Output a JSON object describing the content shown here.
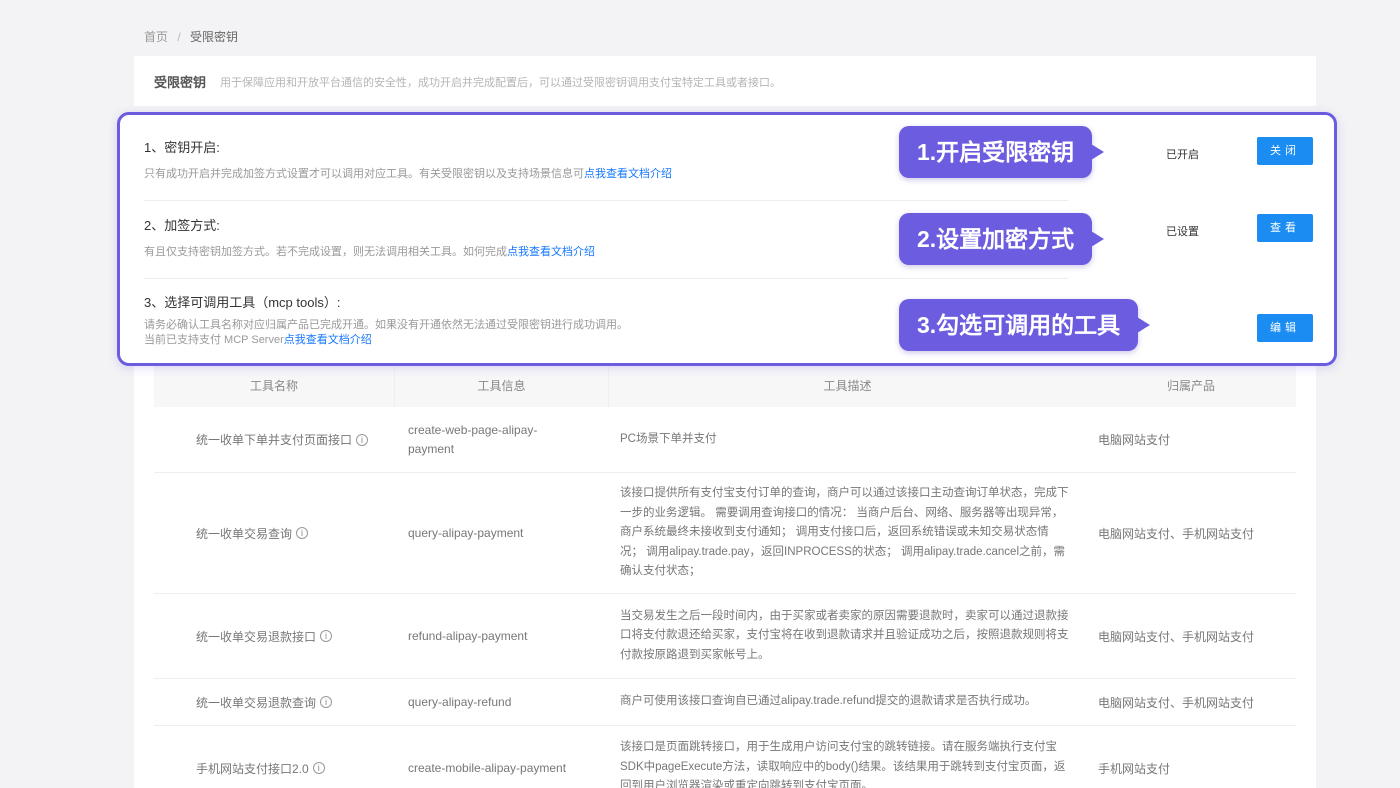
{
  "breadcrumb": {
    "home": "首页",
    "separator": "/",
    "current": "受限密钥"
  },
  "header": {
    "title": "受限密钥",
    "description": "用于保障应用和开放平台通信的安全性，成功开启并完成配置后，可以通过受限密钥调用支付宝特定工具或者接口。"
  },
  "sections": [
    {
      "title": "1、密钥开启:",
      "desc": "只有成功开启并完成加签方式设置才可以调用对应工具。有关受限密钥以及支持场景信息可",
      "link": "点我查看文档介绍",
      "status": "已开启",
      "button": "关闭"
    },
    {
      "title": "2、加签方式:",
      "desc": "有且仅支持密钥加签方式。若不完成设置，则无法调用相关工具。如何完成",
      "link": "点我查看文档介绍",
      "status": "已设置",
      "button": "查看"
    },
    {
      "title": "3、选择可调用工具（mcp tools）:",
      "desc": "请务必确认工具名称对应归属产品已完成开通。如果没有开通依然无法通过受限密钥进行成功调用。",
      "desc2": "当前已支持支付 MCP Server",
      "link": "点我查看文档介绍",
      "status": "",
      "button": "编辑"
    }
  ],
  "callouts": [
    "1.开启受限密钥",
    "2.设置加密方式",
    "3.勾选可调用的工具"
  ],
  "table": {
    "headers": [
      "工具名称",
      "工具信息",
      "工具描述",
      "归属产品"
    ],
    "rows": [
      {
        "name": "统一收单下单并支付页面接口",
        "info": "create-web-page-alipay-payment",
        "desc": "PC场景下单并支付",
        "product": "电脑网站支付"
      },
      {
        "name": "统一收单交易查询",
        "info": "query-alipay-payment",
        "desc": "该接口提供所有支付宝支付订单的查询，商户可以通过该接口主动查询订单状态，完成下一步的业务逻辑。 需要调用查询接口的情况： 当商户后台、网络、服务器等出现异常，商户系统最终未接收到支付通知； 调用支付接口后，返回系统错误或未知交易状态情况； 调用alipay.trade.pay，返回INPROCESS的状态； 调用alipay.trade.cancel之前，需确认支付状态；",
        "product": "电脑网站支付、手机网站支付"
      },
      {
        "name": "统一收单交易退款接口",
        "info": "refund-alipay-payment",
        "desc": "当交易发生之后一段时间内，由于买家或者卖家的原因需要退款时，卖家可以通过退款接口将支付款退还给买家，支付宝将在收到退款请求并且验证成功之后，按照退款规则将支付款按原路退到买家帐号上。",
        "product": "电脑网站支付、手机网站支付"
      },
      {
        "name": "统一收单交易退款查询",
        "info": "query-alipay-refund",
        "desc": "商户可使用该接口查询自已通过alipay.trade.refund提交的退款请求是否执行成功。",
        "product": "电脑网站支付、手机网站支付"
      },
      {
        "name": "手机网站支付接口2.0",
        "info": "create-mobile-alipay-payment",
        "desc": "该接口是页面跳转接口，用于生成用户访问支付宝的跳转链接。请在服务端执行支付宝SDK中pageExecute方法，读取响应中的body()结果。该结果用于跳转到支付宝页面，返回到用户浏览器渲染或重定向跳转到支付宝页面。",
        "product": "手机网站支付"
      }
    ]
  },
  "colors": {
    "accent": "#1b8cf2",
    "callout": "#6b5ce0",
    "link": "#1677ff"
  }
}
